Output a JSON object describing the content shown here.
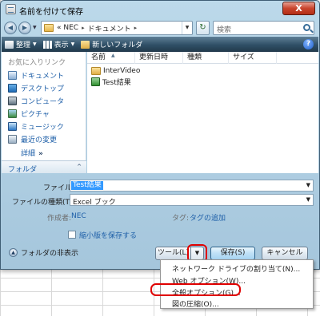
{
  "window": {
    "title": "名前を付けて保存",
    "close_glyph": "X"
  },
  "address": {
    "segments": [
      "« NEC",
      "ドキュメント"
    ],
    "separator": "▸"
  },
  "search": {
    "placeholder": "検索"
  },
  "toolbar": {
    "organize_label": "整理",
    "views_label": "表示",
    "new_folder_label": "新しいフォルダ",
    "help_glyph": "?"
  },
  "nav": {
    "header": "お気に入りリンク",
    "items": [
      {
        "label": "ドキュメント",
        "icon": "documents-icon"
      },
      {
        "label": "デスクトップ",
        "icon": "desktop-icon"
      },
      {
        "label": "コンピュータ",
        "icon": "computer-icon"
      },
      {
        "label": "ピクチャ",
        "icon": "pictures-icon"
      },
      {
        "label": "ミュージック",
        "icon": "music-icon"
      },
      {
        "label": "最近の変更",
        "icon": "recent-icon"
      }
    ],
    "details_label": "詳細",
    "details_chevron": "»",
    "folders_label": "フォルダ",
    "folders_caret": "^"
  },
  "files": {
    "columns": [
      "名前",
      "更新日時",
      "種類",
      "サイズ"
    ],
    "items": [
      {
        "name": "InterVideo",
        "icon": "folder-icon"
      },
      {
        "name": "Test結果",
        "icon": "excel-file-icon"
      }
    ]
  },
  "form": {
    "filename_label": "ファイル名(N):",
    "filename_value": "Test結果",
    "filetype_label": "ファイルの種類(T):",
    "filetype_value": "Excel ブック",
    "author_label": "作成者:",
    "author_value": "NEC",
    "tags_label": "タグ:",
    "tags_value": "タグの追加",
    "thumbnail_label": "縮小版を保存する",
    "thumbnail_checked": false,
    "hide_folders_label": "フォルダの非表示"
  },
  "buttons": {
    "tools_label": "ツール(L)",
    "tools_caret": "▼",
    "save_label": "保存(S)",
    "cancel_label": "キャンセル"
  },
  "tools_menu": {
    "items": [
      "ネットワーク ドライブの割り当て(N)...",
      "Web オプション(W)...",
      "全般オプション(G)...",
      "図の圧縮(O)..."
    ]
  },
  "colors": {
    "highlight_ring": "#e00000",
    "link": "#1e5fa8",
    "selection": "#3399ff"
  }
}
